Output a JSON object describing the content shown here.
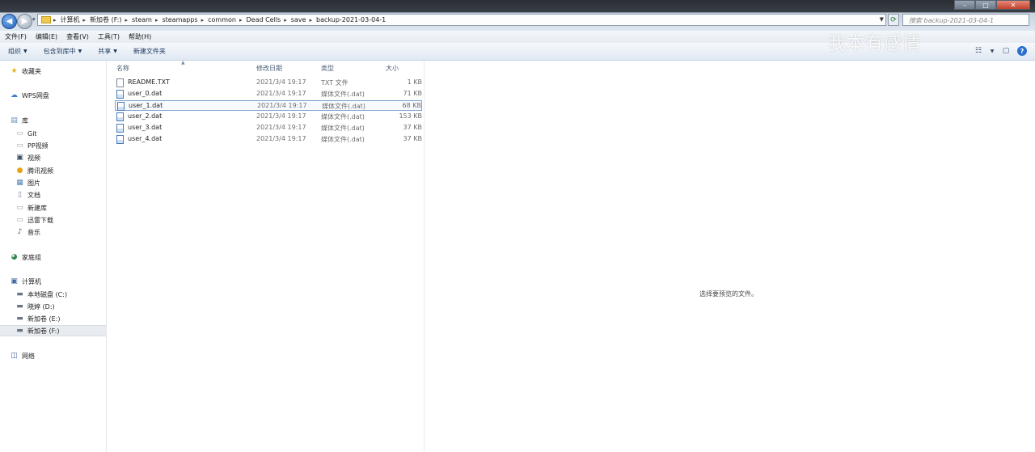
{
  "address_bar": {
    "crumbs": [
      "计算机",
      "新加卷 (F:)",
      "steam",
      "steamapps",
      "common",
      "Dead Cells",
      "save",
      "backup-2021-03-04-1"
    ],
    "search_placeholder": "搜索 backup-2021-03-04-1"
  },
  "menu": [
    "文件(F)",
    "编辑(E)",
    "查看(V)",
    "工具(T)",
    "帮助(H)"
  ],
  "toolbar": {
    "organize": "组织",
    "include_library": "包含到库中",
    "share": "共享",
    "new_folder": "新建文件夹"
  },
  "watermark": "我本有感情",
  "nav": {
    "favorites": "收藏夹",
    "wps": "WPS网盘",
    "library": "库",
    "library_items": [
      "Git",
      "PP视频",
      "视频",
      "腾讯视频",
      "图片",
      "文档",
      "新建库",
      "迅雷下载",
      "音乐"
    ],
    "homegroup": "家庭组",
    "computer": "计算机",
    "drives": [
      "本地磁盘 (C:)",
      "晓婷 (D:)",
      "新加卷 (E:)",
      "新加卷 (F:)"
    ],
    "network": "网络"
  },
  "columns": {
    "name": "名称",
    "date": "修改日期",
    "type": "类型",
    "size": "大小"
  },
  "files": [
    {
      "name": "README.TXT",
      "date": "2021/3/4 19:17",
      "type": "TXT 文件",
      "size": "1 KB"
    },
    {
      "name": "user_0.dat",
      "date": "2021/3/4 19:17",
      "type": "媒体文件(.dat)",
      "size": "71 KB"
    },
    {
      "name": "user_1.dat",
      "date": "2021/3/4 19:17",
      "type": "媒体文件(.dat)",
      "size": "68 KB"
    },
    {
      "name": "user_2.dat",
      "date": "2021/3/4 19:17",
      "type": "媒体文件(.dat)",
      "size": "153 KB"
    },
    {
      "name": "user_3.dat",
      "date": "2021/3/4 19:17",
      "type": "媒体文件(.dat)",
      "size": "37 KB"
    },
    {
      "name": "user_4.dat",
      "date": "2021/3/4 19:17",
      "type": "媒体文件(.dat)",
      "size": "37 KB"
    }
  ],
  "preview": {
    "message": "选择要预览的文件。"
  }
}
